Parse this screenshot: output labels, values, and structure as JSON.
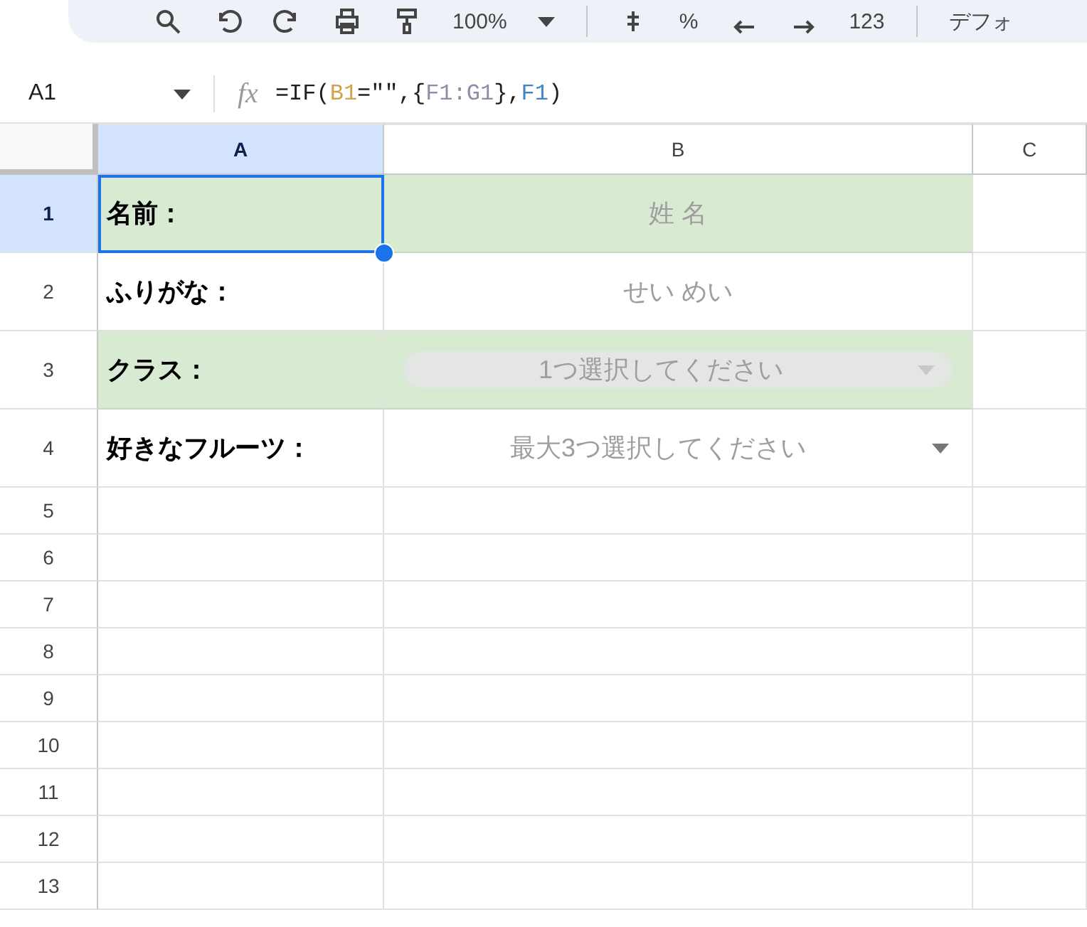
{
  "toolbar": {
    "items": [
      {
        "kind": "search"
      },
      {
        "kind": "undo"
      },
      {
        "kind": "redo"
      },
      {
        "kind": "print"
      },
      {
        "kind": "paint"
      },
      {
        "kind": "text",
        "label": "100%"
      },
      {
        "kind": "caret"
      },
      {
        "kind": "divider"
      },
      {
        "kind": "currency"
      },
      {
        "kind": "text",
        "label": "%"
      },
      {
        "kind": "decimal-left"
      },
      {
        "kind": "decimal-right"
      },
      {
        "kind": "text",
        "label": "123"
      },
      {
        "kind": "divider"
      },
      {
        "kind": "text",
        "label": "デフォ"
      }
    ]
  },
  "formula_bar": {
    "cell_ref": "A1",
    "fx_label": "fx",
    "segments": [
      {
        "text": "=IF(",
        "color": "#1f1f1f"
      },
      {
        "text": "B1",
        "color": "#d4a24c"
      },
      {
        "text": "=\"\",{",
        "color": "#1f1f1f"
      },
      {
        "text": "F1:G1",
        "color": "#8e8ea8"
      },
      {
        "text": "},",
        "color": "#1f1f1f"
      },
      {
        "text": "F1",
        "color": "#3d85c6"
      },
      {
        "text": ")",
        "color": "#1f1f1f"
      }
    ]
  },
  "columns": [
    {
      "label": "A",
      "selected": true
    },
    {
      "label": "B",
      "selected": false
    },
    {
      "label": "C",
      "selected": false
    }
  ],
  "rows": [
    {
      "number": "1",
      "selected": true,
      "shaded": true,
      "label": "名前：",
      "value": "姓 名",
      "kind": "text"
    },
    {
      "number": "2",
      "selected": false,
      "shaded": false,
      "label": "ふりがな：",
      "value": "せい めい",
      "kind": "text"
    },
    {
      "number": "3",
      "selected": false,
      "shaded": true,
      "label": "クラス：",
      "value": "1つ選択してください",
      "kind": "chip-dropdown"
    },
    {
      "number": "4",
      "selected": false,
      "shaded": false,
      "label": "好きなフルーツ：",
      "value": "最大3つ選択してください",
      "kind": "dropdown"
    }
  ],
  "empty_rows": [
    "5",
    "6",
    "7",
    "8",
    "9",
    "10",
    "11",
    "12",
    "13"
  ]
}
